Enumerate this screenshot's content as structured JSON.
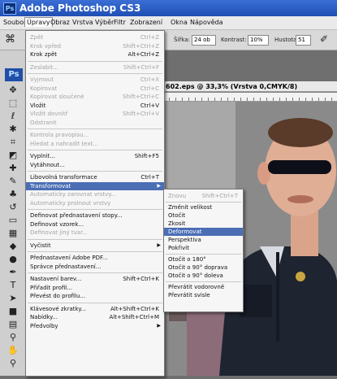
{
  "title": "Adobe Photoshop CS3",
  "ps_badge": "Ps",
  "menubar": [
    "Soubor",
    "Úpravy",
    "Obraz",
    "Vrstva",
    "Výběr",
    "Filtr",
    "Zobrazení",
    "Okna",
    "Nápověda"
  ],
  "options": {
    "sirka_label": "Šířka:",
    "sirka_value": "24 ob",
    "kontrast_label": "Kontrast:",
    "kontrast_value": "10%",
    "hustota_label": "Hustota:",
    "hustota_value": "51"
  },
  "tool_icons": [
    "move-icon",
    "marquee-icon",
    "lasso-icon",
    "magic-wand-icon",
    "crop-icon",
    "slice-icon",
    "healing-icon",
    "brush-icon",
    "stamp-icon",
    "history-brush-icon",
    "eraser-icon",
    "gradient-icon",
    "blur-icon",
    "dodge-icon",
    "pen-icon",
    "type-icon",
    "path-select-icon",
    "shape-icon",
    "notes-icon",
    "eyedropper-icon",
    "hand-icon",
    "zoom-icon"
  ],
  "document": {
    "title": "602.eps @ 33,3% (Vrstva 0,CMYK/8)"
  },
  "edit_menu": [
    {
      "label": "Zpět",
      "shortcut": "Ctrl+Z",
      "disabled": true
    },
    {
      "label": "Krok vpřed",
      "shortcut": "Shift+Ctrl+Z",
      "disabled": true
    },
    {
      "label": "Krok zpět",
      "shortcut": "Alt+Ctrl+Z",
      "disabled": false
    },
    {
      "sep": true
    },
    {
      "label": "Zeslabit...",
      "shortcut": "Shift+Ctrl+F",
      "disabled": true
    },
    {
      "sep": true
    },
    {
      "label": "Vyjmout",
      "shortcut": "Ctrl+X",
      "disabled": true
    },
    {
      "label": "Kopírovat",
      "shortcut": "Ctrl+C",
      "disabled": true
    },
    {
      "label": "Kopírovat sloučené",
      "shortcut": "Shift+Ctrl+C",
      "disabled": true
    },
    {
      "label": "Vložit",
      "shortcut": "Ctrl+V",
      "disabled": false
    },
    {
      "label": "Vložit dovnitř",
      "shortcut": "Shift+Ctrl+V",
      "disabled": true
    },
    {
      "label": "Odstranit",
      "shortcut": "",
      "disabled": true
    },
    {
      "sep": true
    },
    {
      "label": "Kontrola pravopisu...",
      "shortcut": "",
      "disabled": true
    },
    {
      "label": "Hledat a nahradit text...",
      "shortcut": "",
      "disabled": true
    },
    {
      "sep": true
    },
    {
      "label": "Vyplnit...",
      "shortcut": "Shift+F5",
      "disabled": false
    },
    {
      "label": "Vytáhnout...",
      "shortcut": "",
      "disabled": false
    },
    {
      "sep": true
    },
    {
      "label": "Libovolná transformace",
      "shortcut": "Ctrl+T",
      "disabled": false
    },
    {
      "label": "Transformovat",
      "shortcut": "",
      "disabled": false,
      "highlighted": true,
      "submenu": true
    },
    {
      "label": "Automaticky zarovnat vrstvy...",
      "shortcut": "",
      "disabled": true
    },
    {
      "label": "Automaticky prolnout vrstvy",
      "shortcut": "",
      "disabled": true
    },
    {
      "sep": true
    },
    {
      "label": "Definovat přednastavení stopy...",
      "shortcut": "",
      "disabled": false
    },
    {
      "label": "Definovat vzorek...",
      "shortcut": "",
      "disabled": false
    },
    {
      "label": "Definovat jiný tvar...",
      "shortcut": "",
      "disabled": true
    },
    {
      "sep": true
    },
    {
      "label": "Vyčistit",
      "shortcut": "",
      "disabled": false,
      "submenu": true
    },
    {
      "sep": true
    },
    {
      "label": "Přednastavení Adobe PDF...",
      "shortcut": "",
      "disabled": false
    },
    {
      "label": "Správce přednastavení...",
      "shortcut": "",
      "disabled": false
    },
    {
      "sep": true
    },
    {
      "label": "Nastavení barev...",
      "shortcut": "Shift+Ctrl+K",
      "disabled": false
    },
    {
      "label": "Přiřadit profil...",
      "shortcut": "",
      "disabled": false
    },
    {
      "label": "Převést do profilu...",
      "shortcut": "",
      "disabled": false
    },
    {
      "sep": true
    },
    {
      "label": "Klávesové zkratky...",
      "shortcut": "Alt+Shift+Ctrl+K",
      "disabled": false
    },
    {
      "label": "Nabídky...",
      "shortcut": "Alt+Shift+Ctrl+M",
      "disabled": false
    },
    {
      "label": "Předvolby",
      "shortcut": "",
      "disabled": false,
      "submenu": true
    }
  ],
  "transform_menu": [
    {
      "label": "Znovu",
      "shortcut": "Shift+Ctrl+T",
      "disabled": true
    },
    {
      "sep": true
    },
    {
      "label": "Změnit velikost",
      "shortcut": "",
      "disabled": false
    },
    {
      "label": "Otočit",
      "shortcut": "",
      "disabled": false
    },
    {
      "label": "Zkosit",
      "shortcut": "",
      "disabled": false
    },
    {
      "label": "Deformovat",
      "shortcut": "",
      "disabled": false,
      "highlighted": true
    },
    {
      "label": "Perspektiva",
      "shortcut": "",
      "disabled": false
    },
    {
      "label": "Pokřivit",
      "shortcut": "",
      "disabled": false
    },
    {
      "sep": true
    },
    {
      "label": "Otočit o 180°",
      "shortcut": "",
      "disabled": false
    },
    {
      "label": "Otočit o 90° doprava",
      "shortcut": "",
      "disabled": false
    },
    {
      "label": "Otočit o 90° doleva",
      "shortcut": "",
      "disabled": false
    },
    {
      "sep": true
    },
    {
      "label": "Převrátit vodorovně",
      "shortcut": "",
      "disabled": false
    },
    {
      "label": "Převrátit svisle",
      "shortcut": "",
      "disabled": false
    }
  ]
}
